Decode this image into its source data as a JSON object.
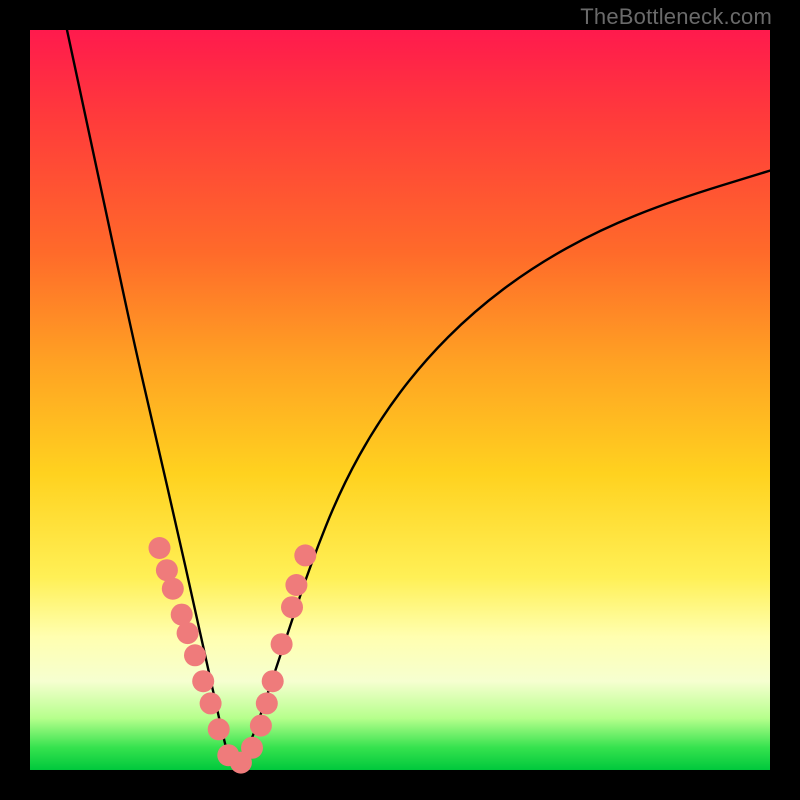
{
  "watermark": "TheBottleneck.com",
  "colors": {
    "frame": "#000000",
    "marker": "#ef7b7b",
    "curve": "#000000",
    "gradient_stops": [
      "#ff1a4d",
      "#ff3b3b",
      "#ff6a2a",
      "#ffa223",
      "#ffd21f",
      "#fff056",
      "#ffffb0",
      "#f6ffd0",
      "#b6ff8c",
      "#35e24e",
      "#00c83c"
    ]
  },
  "chart_data": {
    "type": "line",
    "title": "",
    "xlabel": "",
    "ylabel": "",
    "xlim": [
      0,
      100
    ],
    "ylim": [
      0,
      100
    ],
    "note": "Asymmetric V-shaped bottleneck curve with minimum near x≈27 reaching y≈0; left branch is steep, right branch broader. Values are estimated from pixels on an implied 0–100 scale.",
    "series": [
      {
        "name": "bottleneck-curve",
        "x": [
          5,
          8,
          11,
          14,
          17,
          20,
          22,
          24,
          26,
          27,
          28,
          30,
          32,
          35,
          38,
          42,
          47,
          53,
          60,
          68,
          77,
          87,
          100
        ],
        "values": [
          100,
          86,
          72,
          58,
          45,
          32,
          23,
          14,
          5,
          1,
          1,
          4,
          10,
          19,
          28,
          38,
          47,
          55,
          62,
          68,
          73,
          77,
          81
        ]
      }
    ],
    "markers": {
      "name": "highlighted-points",
      "note": "Pink circular markers clustered along both branches near the bottom of the V (approx. y ≤ 30).",
      "x": [
        17.5,
        18.5,
        19.3,
        20.5,
        21.3,
        22.3,
        23.4,
        24.4,
        25.5,
        26.8,
        28.5,
        30.0,
        31.2,
        32.0,
        32.8,
        34.0,
        35.4,
        36.0,
        37.2
      ],
      "values": [
        30.0,
        27.0,
        24.5,
        21.0,
        18.5,
        15.5,
        12.0,
        9.0,
        5.5,
        2.0,
        1.0,
        3.0,
        6.0,
        9.0,
        12.0,
        17.0,
        22.0,
        25.0,
        29.0
      ]
    }
  }
}
